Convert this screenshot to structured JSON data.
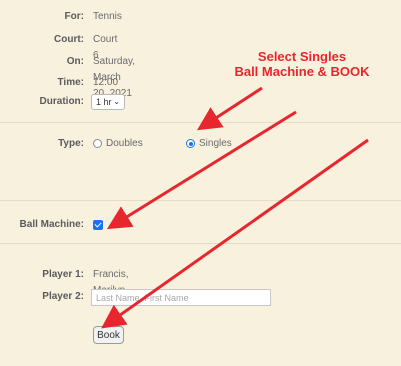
{
  "booking": {
    "for_label": "For:",
    "for_value": "Tennis",
    "court_label": "Court:",
    "court_value": "Court 6",
    "on_label": "On:",
    "on_value": "Saturday, March 20, 2021",
    "time_label": "Time:",
    "time_value": "12:00 pm",
    "duration_label": "Duration:",
    "duration_value": "1 hr"
  },
  "type": {
    "label": "Type:",
    "options": [
      {
        "label": "Doubles",
        "selected": false
      },
      {
        "label": "Singles",
        "selected": true
      }
    ]
  },
  "ball_machine": {
    "label": "Ball Machine:",
    "checked": true
  },
  "players": {
    "player1_label": "Player 1:",
    "player1_value": "Francis, Marilyn",
    "player2_label": "Player 2:",
    "player2_placeholder": "Last Name, First Name"
  },
  "book_button": "Book",
  "annotation": {
    "line1": "Select Singles",
    "line2": "Ball Machine & BOOK",
    "color": "#e8262d"
  },
  "colors": {
    "background": "#f8f1de",
    "accent": "#1a73e8"
  }
}
